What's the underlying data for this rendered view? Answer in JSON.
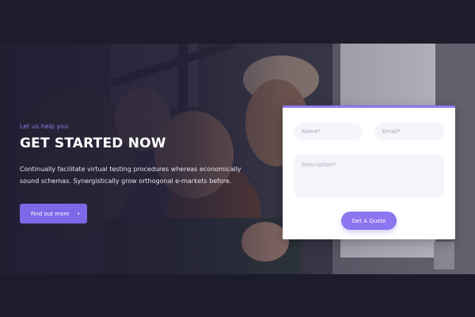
{
  "hero": {
    "eyebrow": "Let us help you",
    "headline": "GET STARTED NOW",
    "description": "Continually facilitate virtual testing procedures whereas economically sound schemas. Synergistically grow orthogonal e-markets before.",
    "cta_label": "Find out more",
    "cta_icon": "chevron-right-icon"
  },
  "form": {
    "name_placeholder": "Name*",
    "email_placeholder": "Email*",
    "description_placeholder": "Description*",
    "submit_label": "Get A Quote"
  },
  "colors": {
    "page_background": "#1d1c2b",
    "accent": "#7e68e8",
    "accent_light": "#8c75ee",
    "field_background": "#f4f5fb"
  }
}
